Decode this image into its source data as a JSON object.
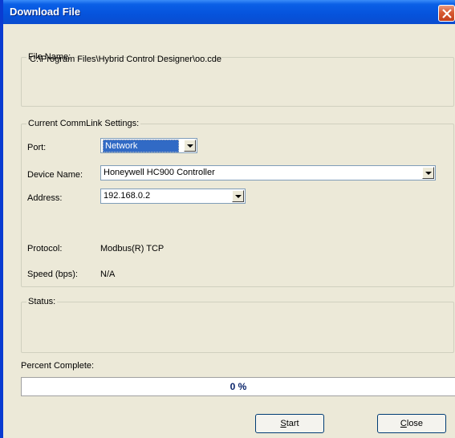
{
  "window": {
    "title": "Download File",
    "close_icon": "close-icon"
  },
  "file_name": {
    "legend": "File Name:",
    "path": "C:\\Program Files\\Hybrid Control Designer\\oo.cde"
  },
  "commlink": {
    "legend": "Current CommLink Settings:",
    "port_label": "Port:",
    "port_value": "Network",
    "device_label": "Device Name:",
    "device_value": "Honeywell HC900 Controller",
    "address_label": "Address:",
    "address_value": "192.168.0.2",
    "protocol_label": "Protocol:",
    "protocol_value": "Modbus(R) TCP",
    "speed_label": "Speed (bps):",
    "speed_value": "N/A"
  },
  "status": {
    "legend": "Status:"
  },
  "progress": {
    "label": "Percent Complete:",
    "value_text": "0 %",
    "fraction": 0.0
  },
  "buttons": {
    "start": "Start",
    "close": "Close"
  },
  "colors": {
    "titlebar": "#0553dc",
    "selection": "#316ac5",
    "progress_text": "#0a246a"
  }
}
